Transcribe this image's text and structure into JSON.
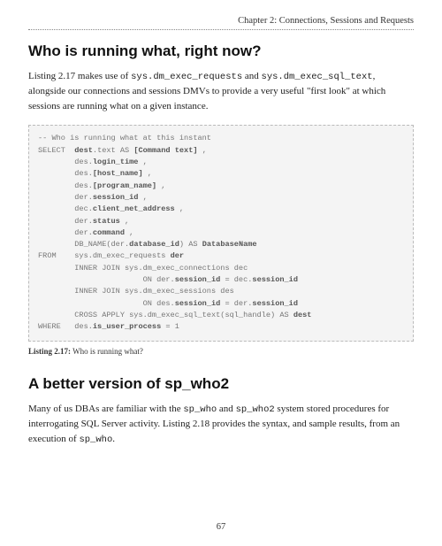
{
  "header": {
    "chapter": "Chapter 2: Connections, Sessions and Requests"
  },
  "section1": {
    "heading": "Who is running what, right now?",
    "para_parts": {
      "p1a": "Listing 2.17 makes use of ",
      "code1": "sys.dm_exec_requests",
      "p1b": " and ",
      "code2": "sys.dm_exec_sql_text",
      "p1c": ", alongside our connections and sessions DMVs to provide a very useful \"first look\" at which sessions are running what on a given instance."
    }
  },
  "code": {
    "l1a": "-- Who is running what at this instant",
    "l2a": "SELECT  ",
    "l2b": "dest",
    "l2c": ".text AS ",
    "l2d": "[Command text]",
    "l2e": " ,",
    "l3a": "        des.",
    "l3b": "login_time",
    "l3c": " ,",
    "l4a": "        des.",
    "l4b": "[host_name]",
    "l4c": " ,",
    "l5a": "        des.",
    "l5b": "[program_name]",
    "l5c": " ,",
    "l6a": "        der.",
    "l6b": "session_id",
    "l6c": " ,",
    "l7a": "        dec.",
    "l7b": "client_net_address",
    "l7c": " ,",
    "l8a": "        der.",
    "l8b": "status",
    "l8c": " ,",
    "l9a": "        der.",
    "l9b": "command",
    "l9c": " ,",
    "l10a": "        DB_NAME(der.",
    "l10b": "database_id",
    "l10c": ") AS ",
    "l10d": "DatabaseName",
    "l11a": "FROM    sys.dm_exec_requests ",
    "l11b": "der",
    "l12a": "        INNER JOIN sys.dm_exec_connections dec",
    "l13a": "                       ON der.",
    "l13b": "session_id",
    "l13c": " = dec.",
    "l13d": "session_id",
    "l14a": "        INNER JOIN sys.dm_exec_sessions des",
    "l15a": "                       ON des.",
    "l15b": "session_id",
    "l15c": " = der.",
    "l15d": "session_id",
    "l16a": "        CROSS APPLY sys.dm_exec_sql_text(sql_handle) AS ",
    "l16b": "dest",
    "l17a": "WHERE   des.",
    "l17b": "is_user_process",
    "l17c": " = 1"
  },
  "caption": {
    "label": "Listing 2.17:",
    "text": "  Who is running what?"
  },
  "section2": {
    "heading": "A better version of sp_who2",
    "para_parts": {
      "p1a": "Many of us DBAs are familiar with the ",
      "code1": "sp_who",
      "p1b": " and ",
      "code2": "sp_who2",
      "p1c": " system stored procedures for interrogating SQL Server activity. Listing 2.18 provides the syntax, and sample results, from an execution of ",
      "code3": "sp_who",
      "p1d": "."
    }
  },
  "pageNumber": "67"
}
